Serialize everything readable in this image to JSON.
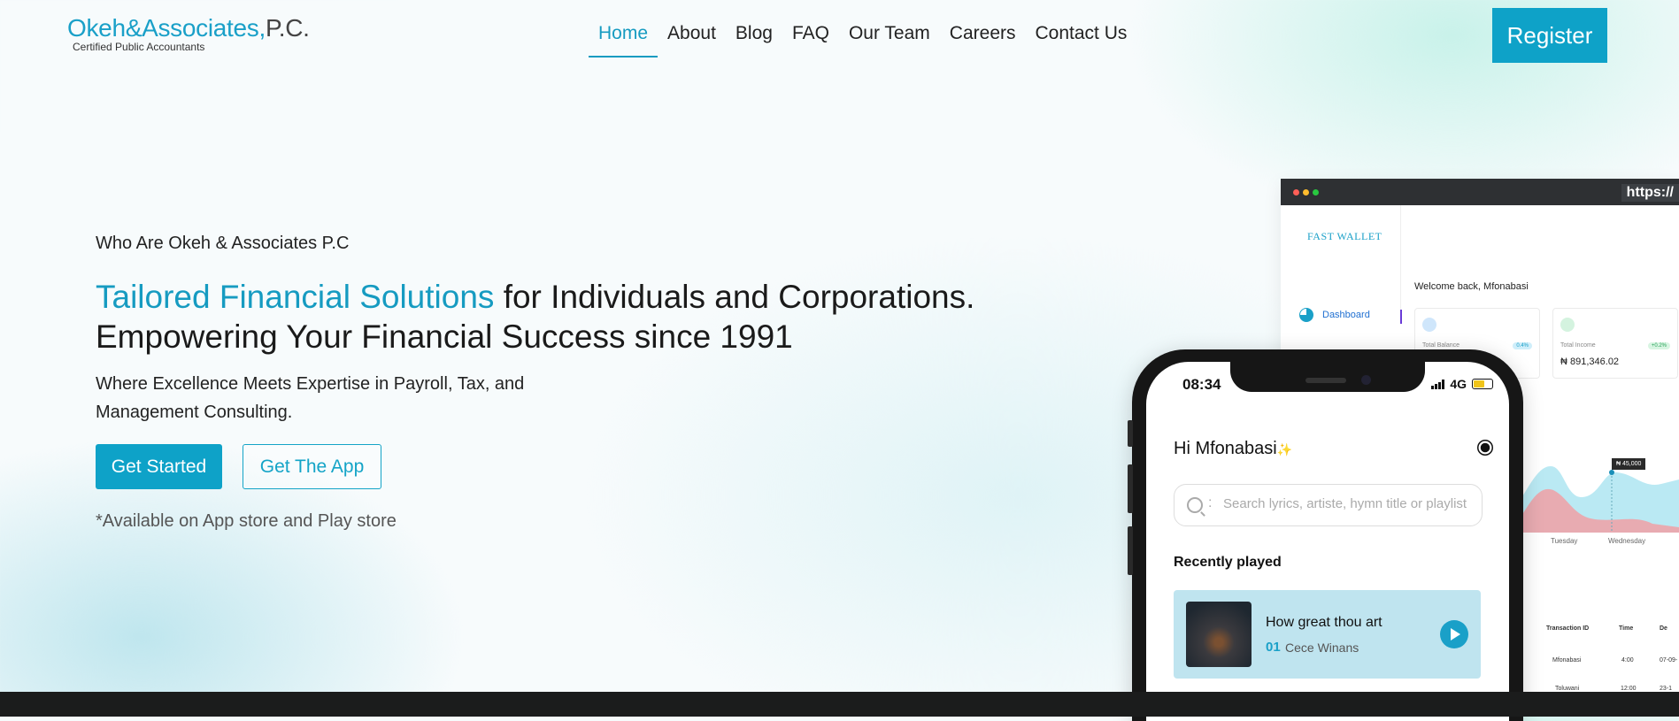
{
  "brand": {
    "name": "Okeh&Associates,",
    "suffix": "P.C.",
    "tagline": "Certified Public Accountants",
    "accent": "#169bc1"
  },
  "nav": {
    "items": [
      "Home",
      "About",
      "Blog",
      "FAQ",
      "Our Team",
      "Careers",
      "Contact Us"
    ],
    "active": "Home",
    "register_label": "Register"
  },
  "hero": {
    "kicker": "Who Are Okeh & Associates P.C",
    "headline_highlight": "Tailored Financial Solutions",
    "headline_rest": " for Individuals and Corporations.",
    "headline_line2": "Empowering Your Financial Success since 1991",
    "subtext": "Where Excellence Meets Expertise in Payroll, Tax, and Management Consulting.",
    "cta_primary": "Get Started",
    "cta_secondary": "Get The App",
    "availability": "*Available on App store and Play store"
  },
  "browser_mock": {
    "url": "https://",
    "app_brand": "FAST WALLET",
    "welcome": "Welcome back, Mfonabasi",
    "nav_item": "Dashboard",
    "cards": [
      {
        "label": "Total Balance",
        "pill": "0.4%",
        "value": ""
      },
      {
        "label": "Total Income",
        "pill": "+0.2%",
        "value": "₦ 891,346.02"
      }
    ],
    "tooltip": "₦ 45,000",
    "days": [
      "Tuesday",
      "Wednesday"
    ],
    "table_headers": [
      "Transaction ID",
      "Time",
      "De"
    ],
    "table_rows": [
      [
        "Mfonabasi",
        "4:00",
        "07-09-"
      ],
      [
        "Toluwani",
        "12:00",
        "23-1"
      ]
    ]
  },
  "phone": {
    "time": "08:34",
    "network": "4G",
    "greeting": "Hi Mfonabasi",
    "search_placeholder": "Search lyrics, artiste, hymn title or playlist",
    "section_title": "Recently played",
    "track": {
      "title": "How great thou art",
      "number": "01",
      "artist": "Cece Winans"
    }
  }
}
